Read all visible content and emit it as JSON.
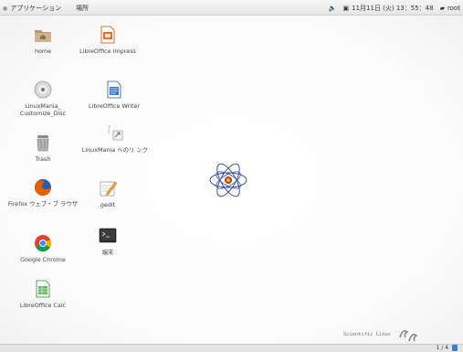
{
  "top_panel": {
    "apps_label": "アプリケーション",
    "places_label": "場所",
    "clock": "11月11日 (火) 13：55：48",
    "user": "root"
  },
  "desktop_icons": [
    {
      "label": "home",
      "icon": "folder-home-icon"
    },
    {
      "label": "LibreOffice Impress",
      "icon": "libreoffice-impress-icon"
    },
    {
      "label": "LinuxMania_ Customize_Disc",
      "icon": "disc-icon"
    },
    {
      "label": "LibreOffice Writer",
      "icon": "libreoffice-writer-icon"
    },
    {
      "label": "Trash",
      "icon": "trash-icon"
    },
    {
      "label": "LinuxMania へのリ ンク",
      "icon": "link-icon"
    },
    {
      "label": "Firefox ウェブ・ブ ラウザ",
      "icon": "firefox-icon"
    },
    {
      "label": "gedit",
      "icon": "gedit-icon"
    },
    {
      "label": "Google Chrome",
      "icon": "chrome-icon"
    },
    {
      "label": "端末",
      "icon": "terminal-icon"
    },
    {
      "label": "LibreOffice Calc",
      "icon": "libreoffice-calc-icon"
    }
  ],
  "branding": {
    "text": "Scientific Linux"
  },
  "bottom_panel": {
    "pager": "1 / 4"
  }
}
